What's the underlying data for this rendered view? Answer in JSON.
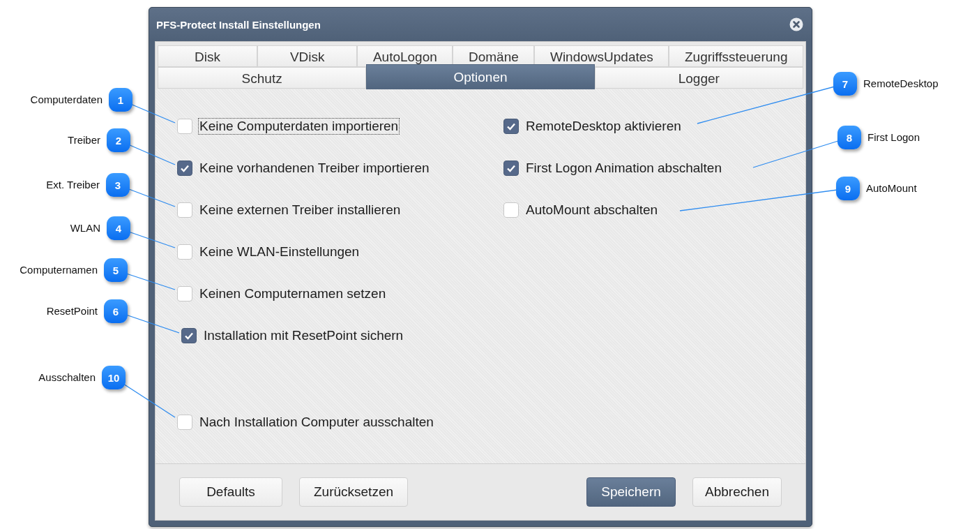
{
  "window": {
    "title": "PFS-Protect Install Einstellungen"
  },
  "tab_rows": [
    [
      {
        "label": "Disk",
        "selected": false
      },
      {
        "label": "VDisk",
        "selected": false
      },
      {
        "label": "AutoLogon",
        "selected": false
      },
      {
        "label": "Domäne",
        "selected": false
      },
      {
        "label": "WindowsUpdates",
        "selected": false
      },
      {
        "label": "Zugriffssteuerung",
        "selected": false
      }
    ],
    [
      {
        "label": "Schutz",
        "selected": false
      },
      {
        "label": "Optionen",
        "selected": true
      },
      {
        "label": "Logger",
        "selected": false
      }
    ]
  ],
  "left_options": [
    {
      "label": "Keine Computerdaten importieren",
      "checked": false,
      "focused": true
    },
    {
      "label": "Keine vorhandenen Treiber importieren",
      "checked": true,
      "focused": false
    },
    {
      "label": "Keine externen Treiber installieren",
      "checked": false,
      "focused": false
    },
    {
      "label": "Keine WLAN-Einstellungen",
      "checked": false,
      "focused": false
    },
    {
      "label": "Keinen Computernamen setzen",
      "checked": false,
      "focused": false
    },
    {
      "label": "Installation mit ResetPoint sichern",
      "checked": true,
      "focused": false
    }
  ],
  "right_options": [
    {
      "label": "RemoteDesktop aktivieren",
      "checked": true,
      "focused": false
    },
    {
      "label": "First Logon Animation abschalten",
      "checked": true,
      "focused": false
    },
    {
      "label": "AutoMount abschalten",
      "checked": false,
      "focused": false
    }
  ],
  "bottom_option": {
    "label": "Nach Installation Computer ausschalten",
    "checked": false,
    "focused": false
  },
  "buttons": [
    {
      "label": "Defaults",
      "primary": false
    },
    {
      "label": "Zurücksetzen",
      "primary": false
    },
    {
      "label": "Speichern",
      "primary": true
    },
    {
      "label": "Abbrechen",
      "primary": false
    }
  ],
  "callouts": [
    {
      "number": "1",
      "label": "Computerdaten"
    },
    {
      "number": "2",
      "label": "Treiber"
    },
    {
      "number": "3",
      "label": "Ext. Treiber"
    },
    {
      "number": "4",
      "label": "WLAN"
    },
    {
      "number": "5",
      "label": "Computernamen"
    },
    {
      "number": "6",
      "label": "ResetPoint"
    },
    {
      "number": "7",
      "label": "RemoteDesktop"
    },
    {
      "number": "8",
      "label": "First Logon"
    },
    {
      "number": "9",
      "label": "AutoMount"
    },
    {
      "number": "10",
      "label": "Ausschalten"
    }
  ]
}
